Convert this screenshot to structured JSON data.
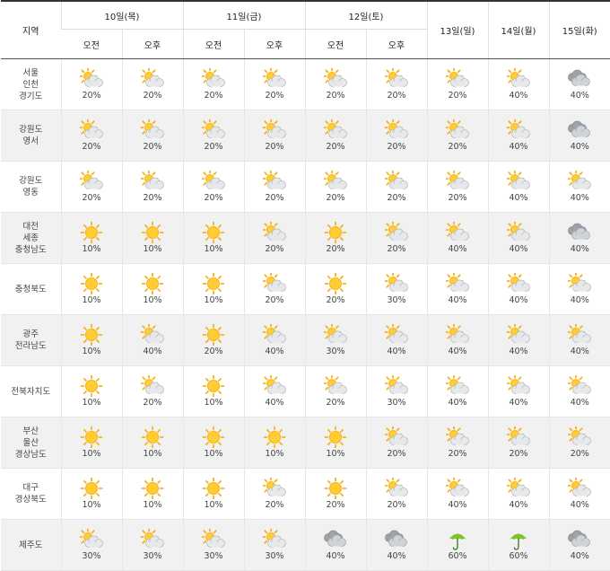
{
  "header": {
    "region_label": "지역",
    "days": [
      {
        "label": "10일(목)"
      },
      {
        "label": "11일(금)"
      },
      {
        "label": "12일(토)"
      },
      {
        "label": "13일(일)"
      },
      {
        "label": "14일(월)"
      },
      {
        "label": "15일(화)"
      }
    ],
    "am_label": "오전",
    "pm_label": "오후"
  },
  "rows": [
    {
      "region": "서울\n인천\n경기도",
      "cells": [
        {
          "icon": "sun-cloud-icon",
          "pct": "20%"
        },
        {
          "icon": "sun-cloud-icon",
          "pct": "20%"
        },
        {
          "icon": "sun-cloud-icon",
          "pct": "20%"
        },
        {
          "icon": "sun-cloud-icon",
          "pct": "20%"
        },
        {
          "icon": "sun-cloud-icon",
          "pct": "20%"
        },
        {
          "icon": "sun-cloud-icon",
          "pct": "20%"
        },
        {
          "icon": "sun-cloud-icon",
          "pct": "20%"
        },
        {
          "icon": "sun-cloud-icon",
          "pct": "40%"
        },
        {
          "icon": "cloud-icon",
          "pct": "40%"
        }
      ]
    },
    {
      "region": "강원도\n영서",
      "cells": [
        {
          "icon": "sun-cloud-icon",
          "pct": "20%"
        },
        {
          "icon": "sun-cloud-icon",
          "pct": "20%"
        },
        {
          "icon": "sun-cloud-icon",
          "pct": "20%"
        },
        {
          "icon": "sun-cloud-icon",
          "pct": "20%"
        },
        {
          "icon": "sun-cloud-icon",
          "pct": "20%"
        },
        {
          "icon": "sun-cloud-icon",
          "pct": "20%"
        },
        {
          "icon": "sun-cloud-icon",
          "pct": "20%"
        },
        {
          "icon": "sun-cloud-icon",
          "pct": "40%"
        },
        {
          "icon": "cloud-icon",
          "pct": "40%"
        }
      ]
    },
    {
      "region": "강원도\n영동",
      "cells": [
        {
          "icon": "sun-cloud-icon",
          "pct": "20%"
        },
        {
          "icon": "sun-cloud-icon",
          "pct": "20%"
        },
        {
          "icon": "sun-cloud-icon",
          "pct": "20%"
        },
        {
          "icon": "sun-cloud-icon",
          "pct": "20%"
        },
        {
          "icon": "sun-cloud-icon",
          "pct": "20%"
        },
        {
          "icon": "sun-cloud-icon",
          "pct": "20%"
        },
        {
          "icon": "sun-cloud-icon",
          "pct": "20%"
        },
        {
          "icon": "sun-cloud-icon",
          "pct": "40%"
        },
        {
          "icon": "sun-cloud-icon",
          "pct": "40%"
        }
      ]
    },
    {
      "region": "대전\n세종\n충청남도",
      "cells": [
        {
          "icon": "sun-icon",
          "pct": "10%"
        },
        {
          "icon": "sun-icon",
          "pct": "10%"
        },
        {
          "icon": "sun-icon",
          "pct": "10%"
        },
        {
          "icon": "sun-cloud-icon",
          "pct": "20%"
        },
        {
          "icon": "sun-icon",
          "pct": "20%"
        },
        {
          "icon": "sun-cloud-icon",
          "pct": "20%"
        },
        {
          "icon": "sun-cloud-icon",
          "pct": "40%"
        },
        {
          "icon": "sun-cloud-icon",
          "pct": "40%"
        },
        {
          "icon": "cloud-icon",
          "pct": "40%"
        }
      ]
    },
    {
      "region": "충청북도",
      "cells": [
        {
          "icon": "sun-icon",
          "pct": "10%"
        },
        {
          "icon": "sun-icon",
          "pct": "10%"
        },
        {
          "icon": "sun-icon",
          "pct": "10%"
        },
        {
          "icon": "sun-cloud-icon",
          "pct": "20%"
        },
        {
          "icon": "sun-icon",
          "pct": "20%"
        },
        {
          "icon": "sun-cloud-icon",
          "pct": "30%"
        },
        {
          "icon": "sun-cloud-icon",
          "pct": "40%"
        },
        {
          "icon": "sun-cloud-icon",
          "pct": "40%"
        },
        {
          "icon": "sun-cloud-icon",
          "pct": "40%"
        }
      ]
    },
    {
      "region": "광주\n전라남도",
      "cells": [
        {
          "icon": "sun-icon",
          "pct": "10%"
        },
        {
          "icon": "sun-cloud-icon",
          "pct": "40%"
        },
        {
          "icon": "sun-icon",
          "pct": "20%"
        },
        {
          "icon": "sun-cloud-icon",
          "pct": "40%"
        },
        {
          "icon": "sun-cloud-icon",
          "pct": "30%"
        },
        {
          "icon": "sun-cloud-icon",
          "pct": "40%"
        },
        {
          "icon": "sun-cloud-icon",
          "pct": "40%"
        },
        {
          "icon": "sun-cloud-icon",
          "pct": "40%"
        },
        {
          "icon": "sun-cloud-icon",
          "pct": "40%"
        }
      ]
    },
    {
      "region": "전북자치도",
      "cells": [
        {
          "icon": "sun-icon",
          "pct": "10%"
        },
        {
          "icon": "sun-cloud-icon",
          "pct": "20%"
        },
        {
          "icon": "sun-icon",
          "pct": "10%"
        },
        {
          "icon": "sun-cloud-icon",
          "pct": "40%"
        },
        {
          "icon": "sun-cloud-icon",
          "pct": "20%"
        },
        {
          "icon": "sun-cloud-icon",
          "pct": "30%"
        },
        {
          "icon": "sun-cloud-icon",
          "pct": "40%"
        },
        {
          "icon": "sun-cloud-icon",
          "pct": "40%"
        },
        {
          "icon": "sun-cloud-icon",
          "pct": "40%"
        }
      ]
    },
    {
      "region": "부산\n울산\n경상남도",
      "cells": [
        {
          "icon": "sun-icon",
          "pct": "10%"
        },
        {
          "icon": "sun-icon",
          "pct": "10%"
        },
        {
          "icon": "sun-icon",
          "pct": "10%"
        },
        {
          "icon": "sun-icon",
          "pct": "10%"
        },
        {
          "icon": "sun-icon",
          "pct": "10%"
        },
        {
          "icon": "sun-cloud-icon",
          "pct": "20%"
        },
        {
          "icon": "sun-cloud-icon",
          "pct": "20%"
        },
        {
          "icon": "sun-cloud-icon",
          "pct": "20%"
        },
        {
          "icon": "sun-cloud-icon",
          "pct": "20%"
        }
      ]
    },
    {
      "region": "대구\n경상북도",
      "cells": [
        {
          "icon": "sun-icon",
          "pct": "10%"
        },
        {
          "icon": "sun-icon",
          "pct": "10%"
        },
        {
          "icon": "sun-icon",
          "pct": "10%"
        },
        {
          "icon": "sun-cloud-icon",
          "pct": "20%"
        },
        {
          "icon": "sun-icon",
          "pct": "20%"
        },
        {
          "icon": "sun-cloud-icon",
          "pct": "20%"
        },
        {
          "icon": "sun-cloud-icon",
          "pct": "40%"
        },
        {
          "icon": "sun-cloud-icon",
          "pct": "40%"
        },
        {
          "icon": "sun-cloud-icon",
          "pct": "40%"
        }
      ]
    },
    {
      "region": "제주도",
      "cells": [
        {
          "icon": "sun-cloud-icon",
          "pct": "30%"
        },
        {
          "icon": "sun-cloud-icon",
          "pct": "30%"
        },
        {
          "icon": "sun-cloud-icon",
          "pct": "30%"
        },
        {
          "icon": "sun-cloud-icon",
          "pct": "30%"
        },
        {
          "icon": "cloud-icon",
          "pct": "40%"
        },
        {
          "icon": "cloud-icon",
          "pct": "40%"
        },
        {
          "icon": "umbrella-icon",
          "pct": "60%"
        },
        {
          "icon": "umbrella-icon",
          "pct": "60%"
        },
        {
          "icon": "cloud-icon",
          "pct": "40%"
        }
      ]
    }
  ],
  "colors": {
    "sun": "#f6b21a",
    "sun_core": "#ffcc33",
    "cloud": "#cfd3d6",
    "cloud_dark": "#9da3a8",
    "umbrella": "#7cc22a",
    "row_alt": "#f1f1f1",
    "header_rule": "#333333"
  }
}
